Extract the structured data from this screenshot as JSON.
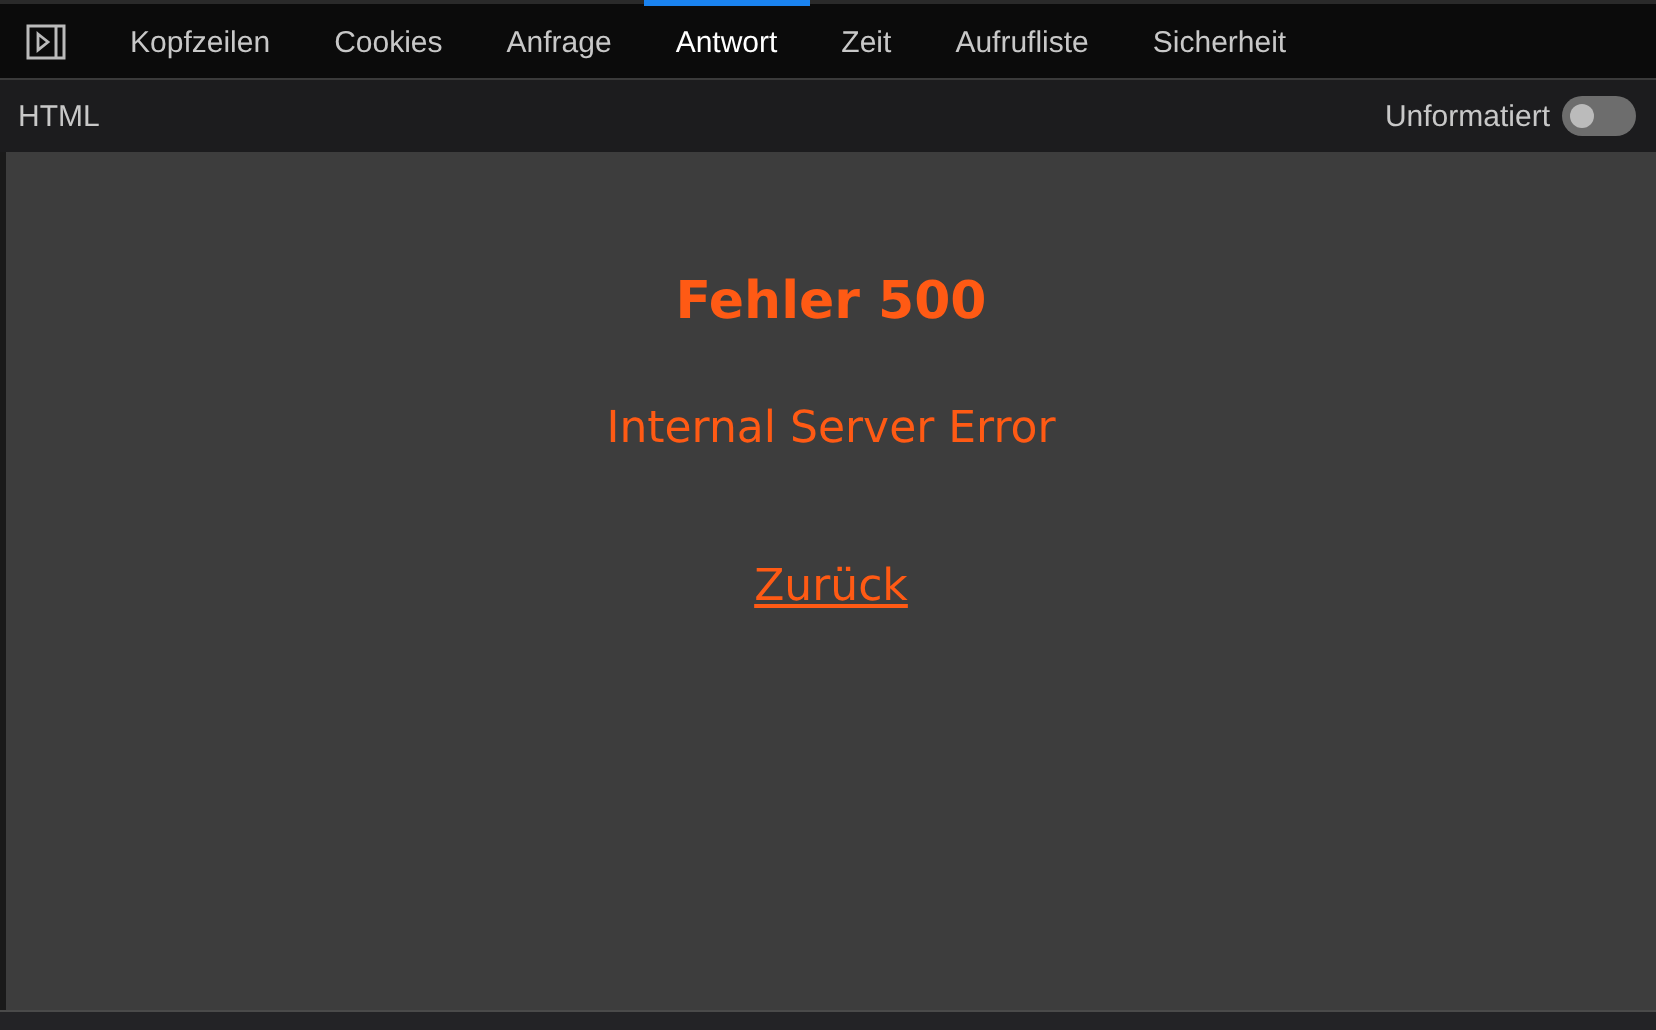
{
  "tabs": [
    {
      "label": "Kopfzeilen",
      "selected": false
    },
    {
      "label": "Cookies",
      "selected": false
    },
    {
      "label": "Anfrage",
      "selected": false
    },
    {
      "label": "Antwort",
      "selected": true
    },
    {
      "label": "Zeit",
      "selected": false
    },
    {
      "label": "Aufrufliste",
      "selected": false
    },
    {
      "label": "Sicherheit",
      "selected": false
    }
  ],
  "toolbar": {
    "format": "HTML",
    "toggle": {
      "label": "Unformatiert",
      "on": false
    }
  },
  "preview": {
    "heading": "Fehler 500",
    "message": "Internal Server Error",
    "link": "Zurück"
  }
}
